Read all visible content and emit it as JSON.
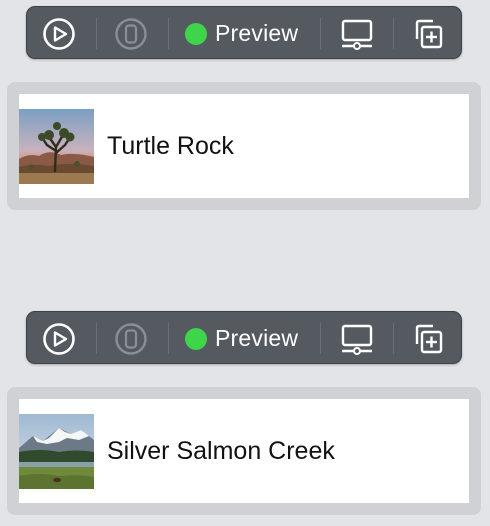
{
  "toolbars": [
    {
      "preview_label": "Preview",
      "status_color": "#3ed54b"
    },
    {
      "preview_label": "Preview",
      "status_color": "#3ed54b"
    }
  ],
  "toolbar_icons": [
    "play-circle-icon",
    "device-icon",
    "display-icon",
    "duplicate-icon"
  ],
  "landmarks": [
    {
      "name": "Turtle Rock",
      "image": "joshua-tree-photo"
    },
    {
      "name": "Silver Salmon Creek",
      "image": "mountain-meadow-photo"
    }
  ]
}
